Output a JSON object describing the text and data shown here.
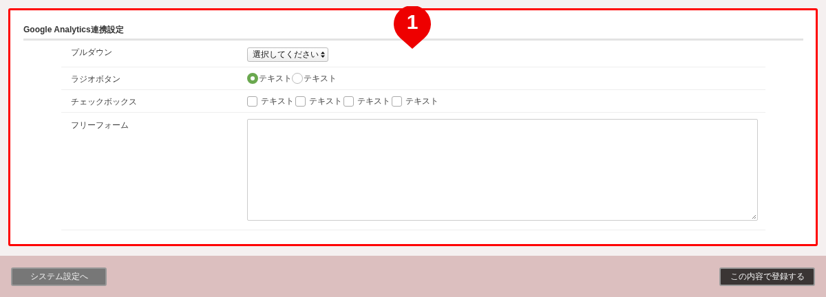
{
  "section": {
    "title": "Google Analytics連携設定"
  },
  "callout": {
    "label": "1"
  },
  "fields": [
    {
      "kind": "select",
      "label": "プルダウン",
      "value": "選択してください"
    },
    {
      "kind": "radio",
      "label": "ラジオボタン",
      "options": [
        {
          "label": "テキスト",
          "selected": true
        },
        {
          "label": "テキスト",
          "selected": false
        }
      ]
    },
    {
      "kind": "checkbox",
      "label": "チェックボックス",
      "options": [
        {
          "label": "テキスト",
          "checked": false
        },
        {
          "label": "テキスト",
          "checked": false
        },
        {
          "label": "テキスト",
          "checked": false
        },
        {
          "label": "テキスト",
          "checked": false
        }
      ]
    },
    {
      "kind": "textarea",
      "label": "フリーフォーム"
    }
  ],
  "footer": {
    "back_button": "システム設定へ",
    "submit_button": "この内容で登録する"
  }
}
